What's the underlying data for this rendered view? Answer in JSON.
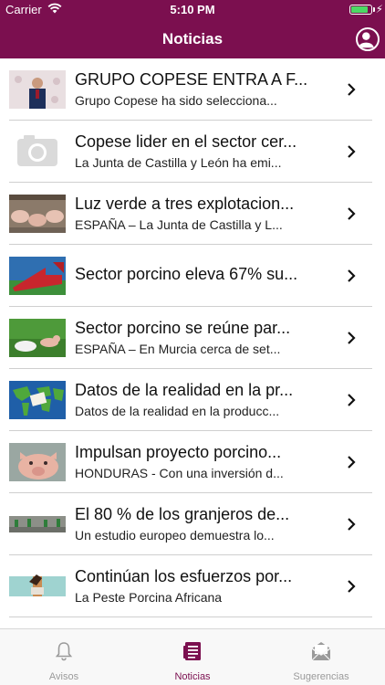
{
  "status_bar": {
    "carrier": "Carrier",
    "time": "5:10 PM",
    "battery_level": 0.9
  },
  "nav": {
    "title": "Noticias"
  },
  "news": [
    {
      "title": "GRUPO COPESE ENTRA A F...",
      "subtitle": "Grupo Copese ha sido selecciona..."
    },
    {
      "title": "Copese lider en el sector cer...",
      "subtitle": "La Junta de Castilla y León ha emi..."
    },
    {
      "title": "Luz verde a tres explotacion...",
      "subtitle": "ESPAÑA – La Junta de Castilla y L..."
    },
    {
      "title": "Sector porcino eleva 67% su..."
    },
    {
      "title": "Sector porcino se reúne par...",
      "subtitle": "ESPAÑA – En Murcia cerca de set..."
    },
    {
      "title": "Datos de la realidad en la pr...",
      "subtitle": "Datos de la realidad en la producc..."
    },
    {
      "title": "Impulsan proyecto porcino...",
      "subtitle": "HONDURAS - Con una inversión d..."
    },
    {
      "title": "El 80 % de los granjeros de...",
      "subtitle": "Un estudio europeo demuestra lo..."
    },
    {
      "title": "Continúan los esfuerzos por...",
      "subtitle": "La Peste Porcina Africana"
    }
  ],
  "tabs": [
    {
      "label": "Avisos",
      "icon": "bell-icon",
      "active": false
    },
    {
      "label": "Noticias",
      "icon": "news-icon",
      "active": true
    },
    {
      "label": "Sugerencias",
      "icon": "mail-icon",
      "active": false
    }
  ],
  "colors": {
    "brand": "#7b0f4f",
    "inactive_tab": "#9a9a9a",
    "battery": "#4cd964"
  }
}
